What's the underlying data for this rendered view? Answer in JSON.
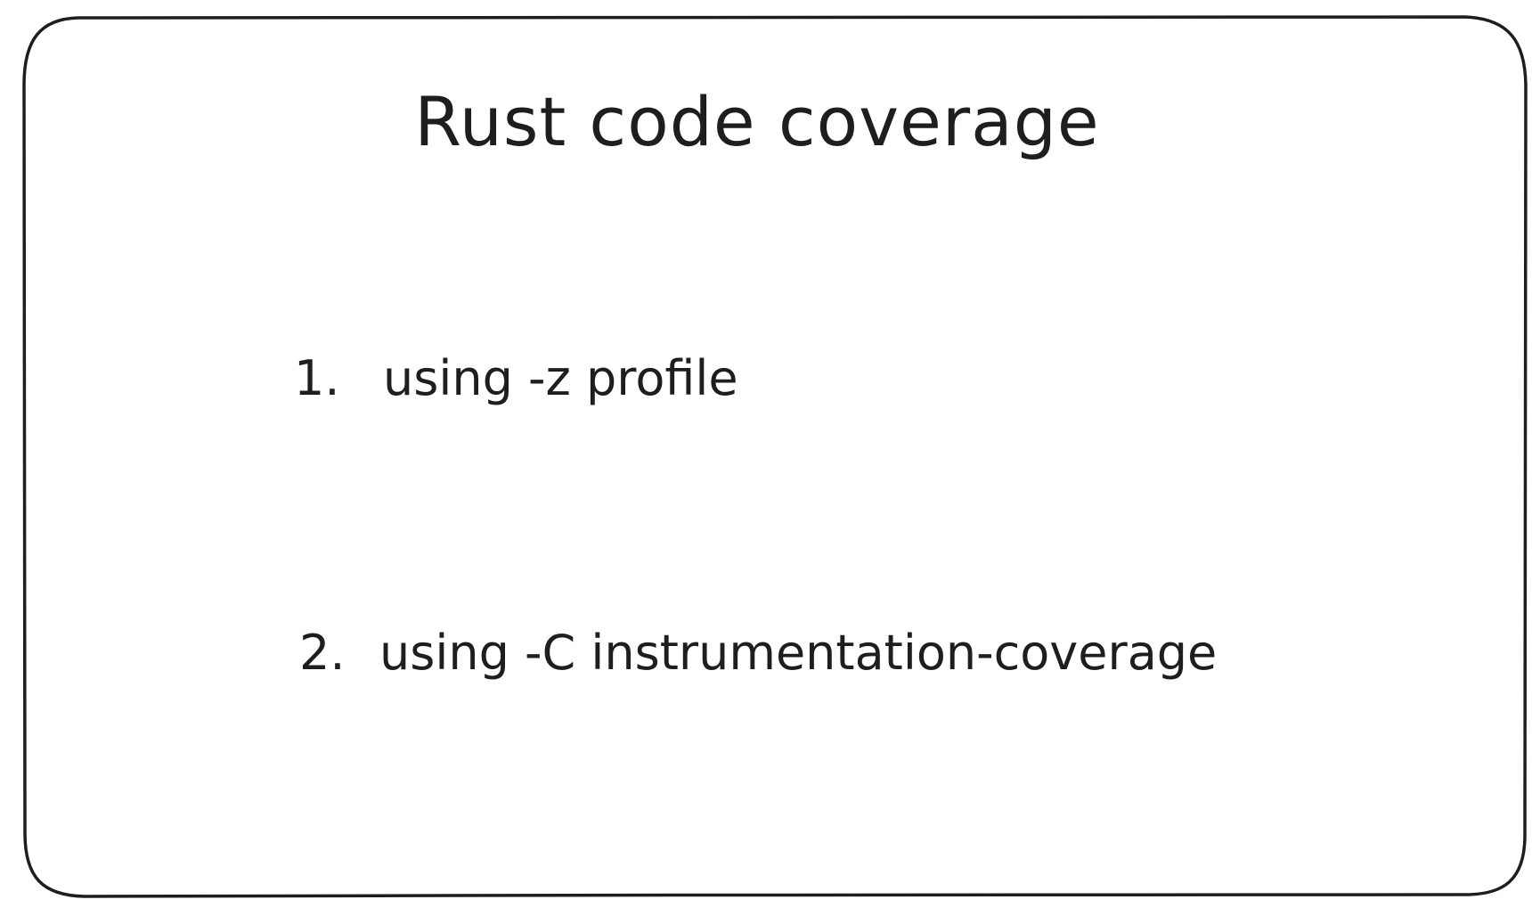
{
  "title": "Rust code coverage",
  "items": [
    {
      "number": "1.",
      "text": "using -z profile"
    },
    {
      "number": "2.",
      "text": "using -C instrumentation-coverage"
    }
  ],
  "colors": {
    "stroke": "#1e1e1e",
    "background": "#ffffff"
  }
}
